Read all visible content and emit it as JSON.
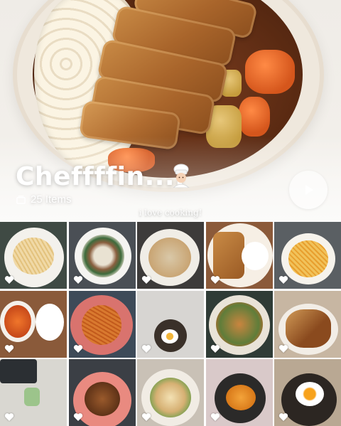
{
  "album": {
    "title": "Cheffffin....",
    "items_count": "25 Items",
    "subtitle": "i love cooking!",
    "title_emoji": "chef-emoji",
    "items_icon": "stack-icon",
    "play_icon": "play-icon"
  },
  "colors": {
    "heart": "#ffffff",
    "title": "#ffffff",
    "play_bg": "rgba(255,255,255,0.55)"
  },
  "tiles": [
    {
      "icon": "heart-icon",
      "liked": true
    },
    {
      "icon": "heart-icon",
      "liked": true
    },
    {
      "icon": "heart-icon",
      "liked": true
    },
    {
      "icon": "heart-icon",
      "liked": true
    },
    {
      "icon": "heart-icon",
      "liked": true
    },
    {
      "icon": "heart-icon",
      "liked": true
    },
    {
      "icon": "heart-icon",
      "liked": true
    },
    {
      "icon": "heart-icon",
      "liked": true
    },
    {
      "icon": "heart-icon",
      "liked": true
    },
    {
      "icon": "heart-icon",
      "liked": true
    },
    {
      "icon": "heart-icon",
      "liked": true
    },
    {
      "icon": "heart-icon",
      "liked": true
    },
    {
      "icon": "heart-icon",
      "liked": true
    },
    {
      "icon": "heart-icon",
      "liked": true
    },
    {
      "icon": "heart-icon",
      "liked": true
    }
  ]
}
